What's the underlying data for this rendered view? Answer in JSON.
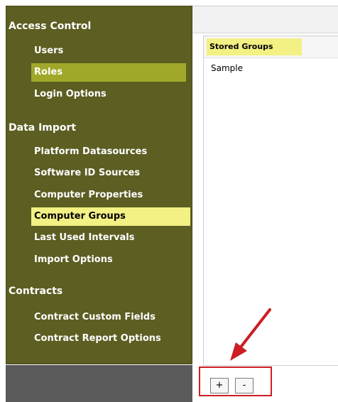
{
  "sidebar": {
    "sections": [
      {
        "title": "Access Control",
        "items": [
          {
            "label": "Users"
          },
          {
            "label": "Roles"
          },
          {
            "label": "Login Options"
          }
        ]
      },
      {
        "title": "Data Import",
        "items": [
          {
            "label": "Platform Datasources"
          },
          {
            "label": "Software ID Sources"
          },
          {
            "label": "Computer Properties"
          },
          {
            "label": "Computer Groups"
          },
          {
            "label": "Last Used Intervals"
          },
          {
            "label": "Import Options"
          }
        ]
      },
      {
        "title": "Contracts",
        "items": [
          {
            "label": "Contract Custom Fields"
          },
          {
            "label": "Contract Report Options"
          }
        ]
      }
    ],
    "selected_item": "Computer Groups",
    "highlighted_item": "Roles"
  },
  "main": {
    "list_header": "Stored Groups",
    "rows": [
      "Sample"
    ],
    "add_button": "+",
    "remove_button": "-"
  },
  "colors": {
    "sidebar_bg": "#5c5e22",
    "roles_highlight": "#a0a82a",
    "selected_highlight": "#f3f084",
    "annotation_red": "#cc1d25"
  },
  "icons": {
    "annotation": "red-arrow-icon"
  }
}
